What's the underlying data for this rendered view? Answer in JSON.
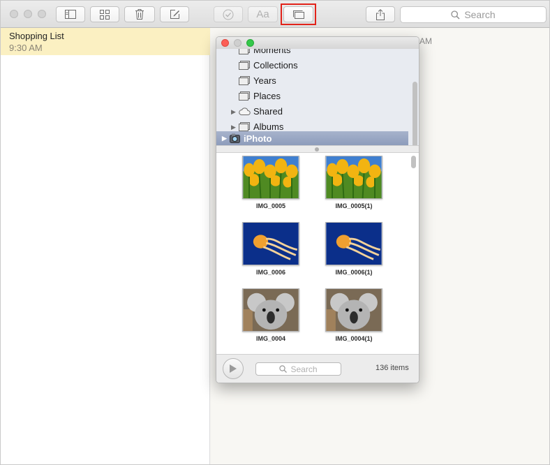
{
  "toolbar": {
    "search_placeholder": "Search",
    "font_label": "Aa",
    "icons": [
      "sidebar-toggle-icon",
      "attachments-grid-icon",
      "trash-icon",
      "compose-icon",
      "checklist-icon",
      "font-icon",
      "photo-browser-icon",
      "share-icon",
      "search-icon"
    ]
  },
  "notes": [
    {
      "title": "Shopping List",
      "time": "9:30 AM"
    }
  ],
  "note_body": {
    "partial_time": "AM"
  },
  "photo_browser": {
    "sources": [
      {
        "label": "Moments",
        "icon": "album-icon",
        "arrow": false
      },
      {
        "label": "Collections",
        "icon": "album-icon",
        "arrow": false
      },
      {
        "label": "Years",
        "icon": "album-icon",
        "arrow": false
      },
      {
        "label": "Places",
        "icon": "album-icon",
        "arrow": false
      },
      {
        "label": "Shared",
        "icon": "cloud-icon",
        "arrow": true
      },
      {
        "label": "Albums",
        "icon": "album-icon",
        "arrow": true
      },
      {
        "label": "iPhoto",
        "icon": "iphoto-icon",
        "arrow": true,
        "selected": true
      }
    ],
    "photos": [
      {
        "name": "IMG_0005",
        "subject": "tulips"
      },
      {
        "name": "IMG_0005(1)",
        "subject": "tulips"
      },
      {
        "name": "IMG_0006",
        "subject": "jellyfish"
      },
      {
        "name": "IMG_0006(1)",
        "subject": "jellyfish"
      },
      {
        "name": "IMG_0004",
        "subject": "koala"
      },
      {
        "name": "IMG_0004(1)",
        "subject": "koala"
      }
    ],
    "search_placeholder": "Search",
    "item_count": "136 items"
  },
  "colors": {
    "note_highlight": "#fbf0c2",
    "selection": "#8d9cbb",
    "callout": "#e2231a"
  }
}
